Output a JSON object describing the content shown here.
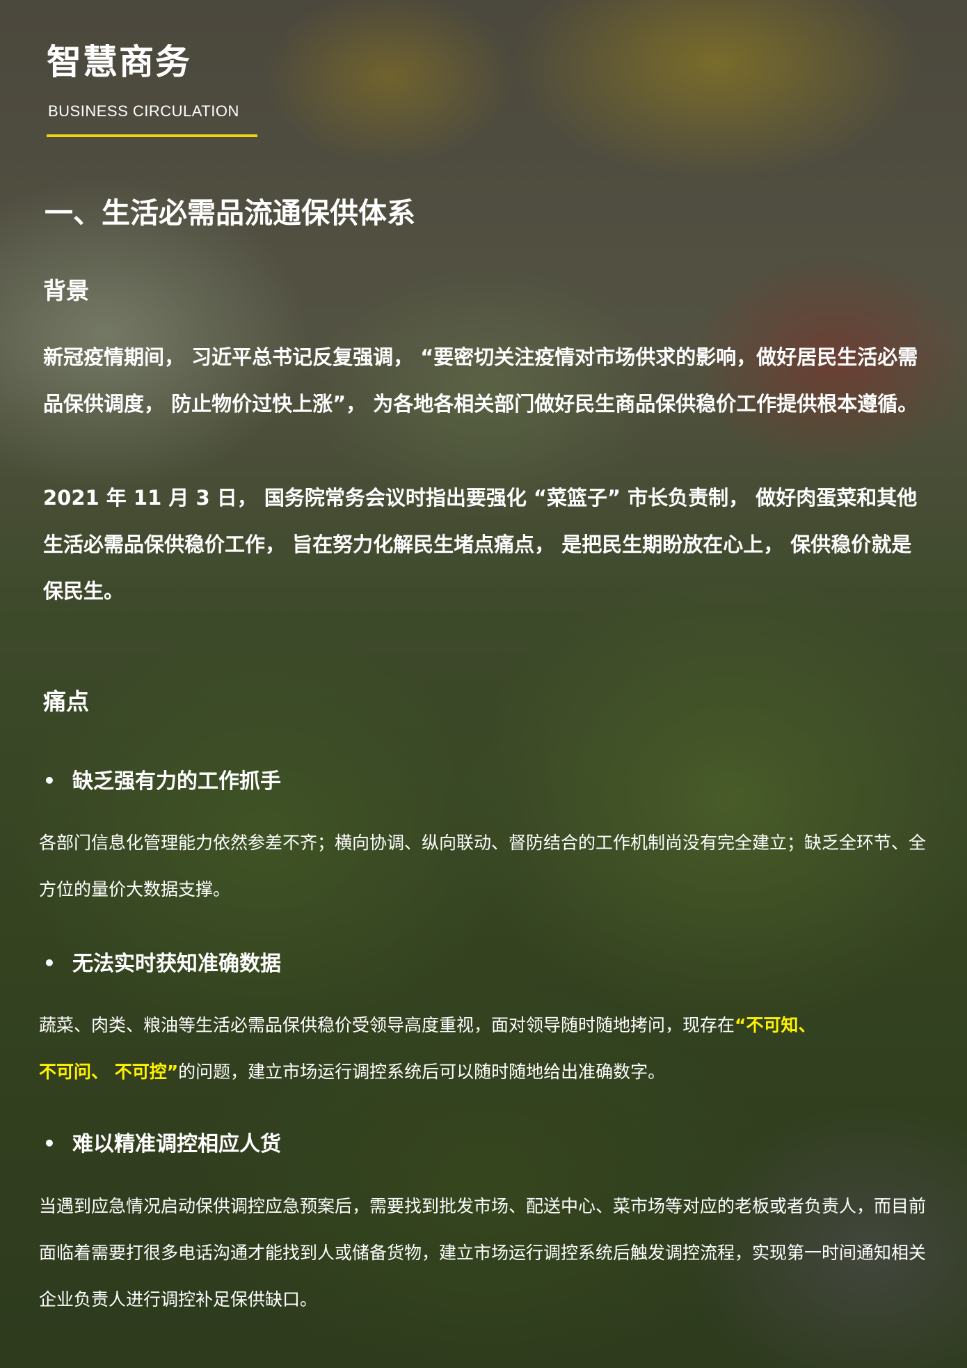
{
  "header": {
    "title": "智慧商务",
    "subtitle": "BUSINESS CIRCULATION"
  },
  "section": {
    "title": "一、生活必需品流通保供体系"
  },
  "background": {
    "label": "背景",
    "paragraph1": "新冠疫情期间， 习近平总书记反复强调， “要密切关注疫情对市场供求的影响，做好居民生活必需品保供调度， 防止物价过快上涨”， 为各地各相关部门做好民生商品保供稳价工作提供根本遵循。",
    "paragraph2": "2021 年 11 月 3 日， 国务院常务会议时指出要强化 “菜篮子” 市长负责制， 做好肉蛋菜和其他生活必需品保供稳价工作， 旨在努力化解民生堵点痛点， 是把民生期盼放在心上， 保供稳价就是保民生。"
  },
  "pain_points": {
    "label": "痛点",
    "bullet_symbol": "•",
    "items": [
      {
        "title": "缺乏强有力的工作抓手",
        "body": "各部门信息化管理能力依然参差不齐；横向协调、纵向联动、督防结合的工作机制尚没有完全建立；缺乏全环节、全方位的量价大数据支撑。"
      },
      {
        "title": "无法实时获知准确数据",
        "body_before": "蔬菜、肉类、粮油等生活必需品保供稳价受领导高度重视，面对领导随时随地拷问，现存在",
        "body_highlight_1": "“不可知、",
        "body_highlight_2": "不可问、 不可控”",
        "body_after": "的问题，建立市场运行调控系统后可以随时随地给出准确数字。"
      },
      {
        "title": "难以精准调控相应人货",
        "body": "当遇到应急情况启动保供调控应急预案后，需要找到批发市场、配送中心、菜市场等对应的老板或者负责人，而目前面临着需要打很多电话沟通才能找到人或储备货物，建立市场运行调控系统后触发调控流程，实现第一时间通知相关企业负责人进行调控补足保供缺口。"
      }
    ]
  },
  "colors": {
    "accent": "#f2d313",
    "highlight": "#fff200",
    "text": "#ffffff"
  }
}
